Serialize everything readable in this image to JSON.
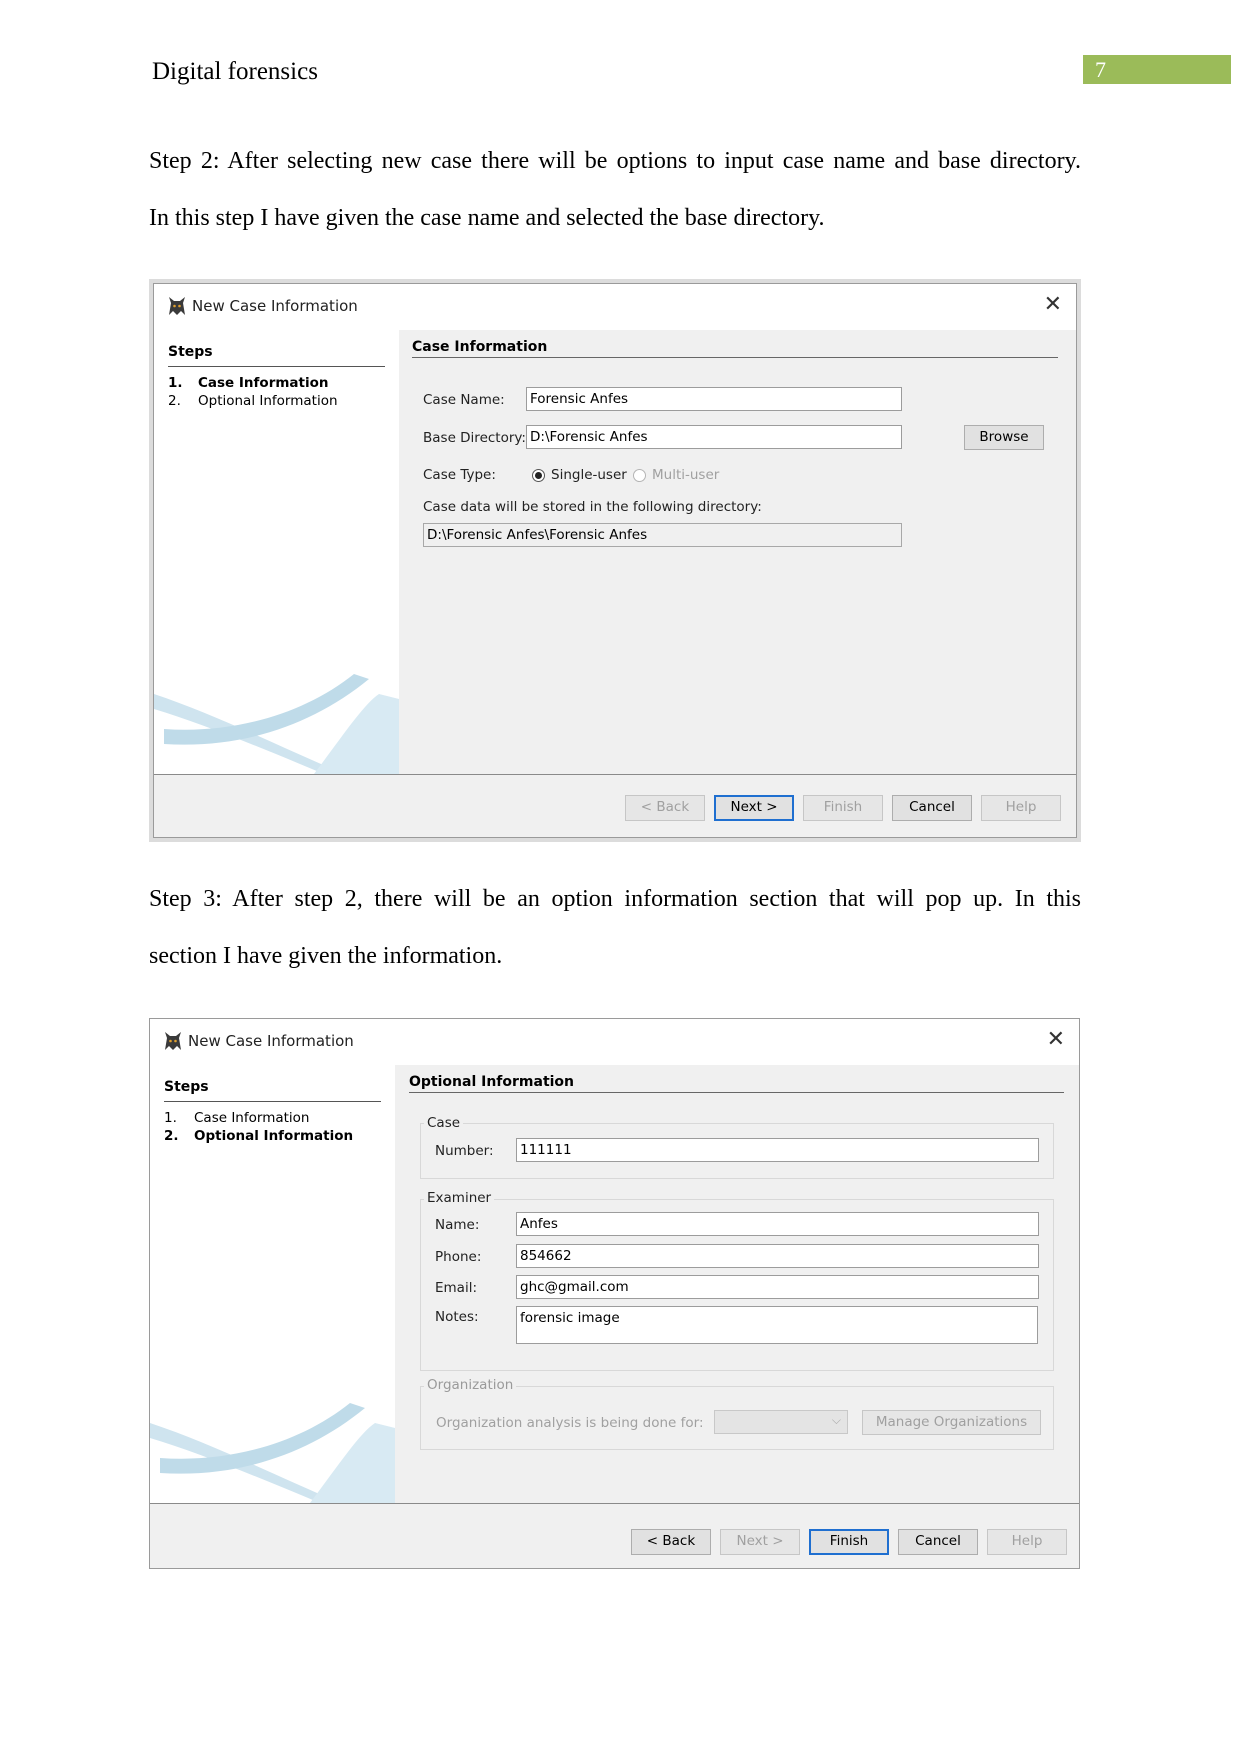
{
  "header": {
    "title": "Digital forensics",
    "page_number": "7"
  },
  "paragraphs": {
    "step2_line1": "Step 2: After selecting new case there will be options to input case name and base directory.",
    "step2_line2": "In this step I have given the case name and selected the base directory.",
    "step3_line1": "Step 3: After step 2, there will be an option information section that will pop up. In this",
    "step3_line2": "section I have given the information."
  },
  "dialog1": {
    "title": "New Case Information",
    "steps_heading": "Steps",
    "steps": [
      {
        "num": "1.",
        "label": "Case Information"
      },
      {
        "num": "2.",
        "label": "Optional Information"
      }
    ],
    "section_heading": "Case Information",
    "case_name_label": "Case Name:",
    "case_name_value": "Forensic Anfes",
    "base_dir_label": "Base Directory:",
    "base_dir_value": "D:\\Forensic Anfes",
    "browse_button": "Browse",
    "case_type_label": "Case Type:",
    "single_user": "Single-user",
    "multi_user": "Multi-user",
    "storage_note": "Case data will be stored in the following directory:",
    "storage_path": "D:\\Forensic Anfes\\Forensic Anfes",
    "buttons": {
      "back": "< Back",
      "next": "Next >",
      "finish": "Finish",
      "cancel": "Cancel",
      "help": "Help"
    }
  },
  "dialog2": {
    "title": "New Case Information",
    "steps_heading": "Steps",
    "steps": [
      {
        "num": "1.",
        "label": "Case Information"
      },
      {
        "num": "2.",
        "label": "Optional Information"
      }
    ],
    "section_heading": "Optional Information",
    "case_group": "Case",
    "number_label": "Number:",
    "number_value": "111111",
    "examiner_group": "Examiner",
    "name_label": "Name:",
    "name_value": "Anfes",
    "phone_label": "Phone:",
    "phone_value": "854662",
    "email_label": "Email:",
    "email_value": "ghc@gmail.com",
    "notes_label": "Notes:",
    "notes_value": "forensic image",
    "organization_group": "Organization",
    "org_analysis_label": "Organization analysis is being done for:",
    "manage_orgs_button": "Manage Organizations",
    "buttons": {
      "back": "< Back",
      "next": "Next >",
      "finish": "Finish",
      "cancel": "Cancel",
      "help": "Help"
    }
  },
  "colors": {
    "page_number_bg": "#9bbb59",
    "default_button_border": "#1f6fd0"
  },
  "icons": {
    "app_icon": "autopsy-dog-icon",
    "close": "close-icon",
    "dropdown": "chevron-down-icon"
  }
}
